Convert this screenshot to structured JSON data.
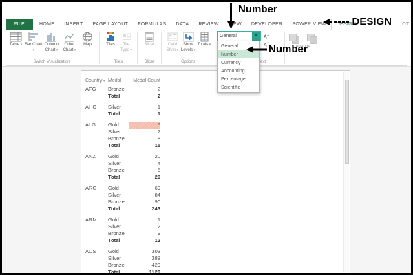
{
  "annotations": {
    "number_top": "Number",
    "design": "DESIGN",
    "number_dropdown": "Number"
  },
  "ribbon": {
    "tabs": [
      {
        "label": "FILE",
        "type": "file"
      },
      {
        "label": "HOME"
      },
      {
        "label": "INSERT"
      },
      {
        "label": "PAGE LAYOUT"
      },
      {
        "label": "FORMULAS"
      },
      {
        "label": "DATA"
      },
      {
        "label": "REVIEW"
      },
      {
        "label": "VIEW"
      },
      {
        "label": "DEVELOPER"
      },
      {
        "label": "POWER VIEW"
      },
      {
        "label": "DESIGN",
        "active": true
      },
      {
        "label": "OT",
        "cut": true
      }
    ],
    "buttons": {
      "table": "Table",
      "bar_chart": "Bar Chart",
      "column_chart": "Column Chart",
      "other_chart": "Other Chart",
      "map": "Map",
      "tiles": "Tiles",
      "tile_type": "Tile Type",
      "slicer": "Slicer",
      "card_style": "Card Style",
      "show_levels": "Show Levels",
      "totals": "Totals"
    },
    "group_labels": {
      "switch_visualization": "Switch Visualization",
      "tiles": "Tiles",
      "slicer": "Slicer",
      "options": "Options",
      "text": "Text",
      "arrange": "Arrange"
    },
    "number_format": {
      "value": "General",
      "options": [
        "General",
        "Number",
        "Currency",
        "Accounting",
        "Percentage",
        "Scientific"
      ],
      "highlighted": "Number"
    }
  },
  "table": {
    "headers": {
      "country": "Country",
      "medal": "Medal",
      "medal_count": "Medal Count"
    },
    "total_label": "Total",
    "groups": [
      {
        "country": "AFG",
        "rows": [
          {
            "medal": "Bronze",
            "count": "2"
          }
        ],
        "total": "2"
      },
      {
        "country": "AHO",
        "rows": [
          {
            "medal": "Silver",
            "count": "1"
          }
        ],
        "total": "1"
      },
      {
        "country": "ALG",
        "rows": [
          {
            "medal": "Gold",
            "count": "5",
            "highlight": true
          },
          {
            "medal": "Silver",
            "count": "2"
          },
          {
            "medal": "Bronze",
            "count": "8"
          }
        ],
        "total": "15"
      },
      {
        "country": "ANZ",
        "rows": [
          {
            "medal": "Gold",
            "count": "20"
          },
          {
            "medal": "Silver",
            "count": "4"
          },
          {
            "medal": "Bronze",
            "count": "5"
          }
        ],
        "total": "29"
      },
      {
        "country": "ARG",
        "rows": [
          {
            "medal": "Gold",
            "count": "69"
          },
          {
            "medal": "Silver",
            "count": "84"
          },
          {
            "medal": "Bronze",
            "count": "90"
          }
        ],
        "total": "243"
      },
      {
        "country": "ARM",
        "rows": [
          {
            "medal": "Gold",
            "count": "1"
          },
          {
            "medal": "Silver",
            "count": "2"
          },
          {
            "medal": "Bronze",
            "count": "9"
          }
        ],
        "total": "12"
      },
      {
        "country": "AUS",
        "rows": [
          {
            "medal": "Gold",
            "count": "303"
          },
          {
            "medal": "Silver",
            "count": "388"
          },
          {
            "medal": "Bronze",
            "count": "429"
          }
        ],
        "total": "1120"
      }
    ],
    "colors": {
      "highlight_cell": "#f3b9a9",
      "dropdown_highlight": "#c9e9d6",
      "file_tab_green": "#217346"
    }
  }
}
